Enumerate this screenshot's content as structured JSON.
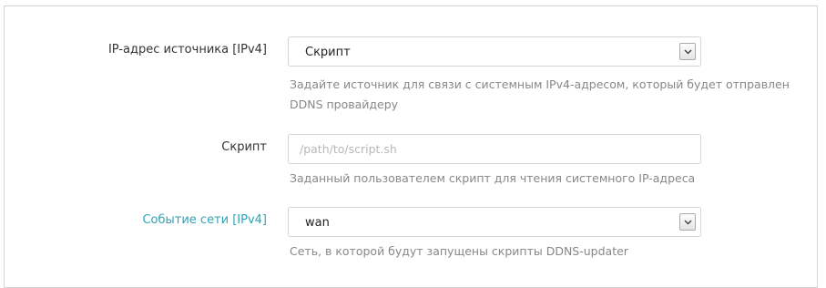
{
  "fields": [
    {
      "label": "IP-адрес источника [IPv4]",
      "type": "select",
      "value": "Скрипт",
      "help": "Задайте источник для связи с системным IPv4-адресом, который будет отправлен DDNS провайдеру"
    },
    {
      "label": "Скрипт",
      "type": "input",
      "value": "",
      "placeholder": "/path/to/script.sh",
      "help": "Заданный пользователем скрипт для чтения системного IP-адреса"
    },
    {
      "label": "Событие сети [IPv4]",
      "type": "select",
      "value": "wan",
      "help": "Сеть, в которой будут запущены скрипты DDNS-updater"
    }
  ],
  "colors": {
    "label": "#333333",
    "label_accent": "#2ea3b5",
    "help": "#888888",
    "border": "#d4d4d4",
    "placeholder": "#b8b8b8"
  },
  "icons": {
    "select_arrow": "chevron-down-icon"
  }
}
